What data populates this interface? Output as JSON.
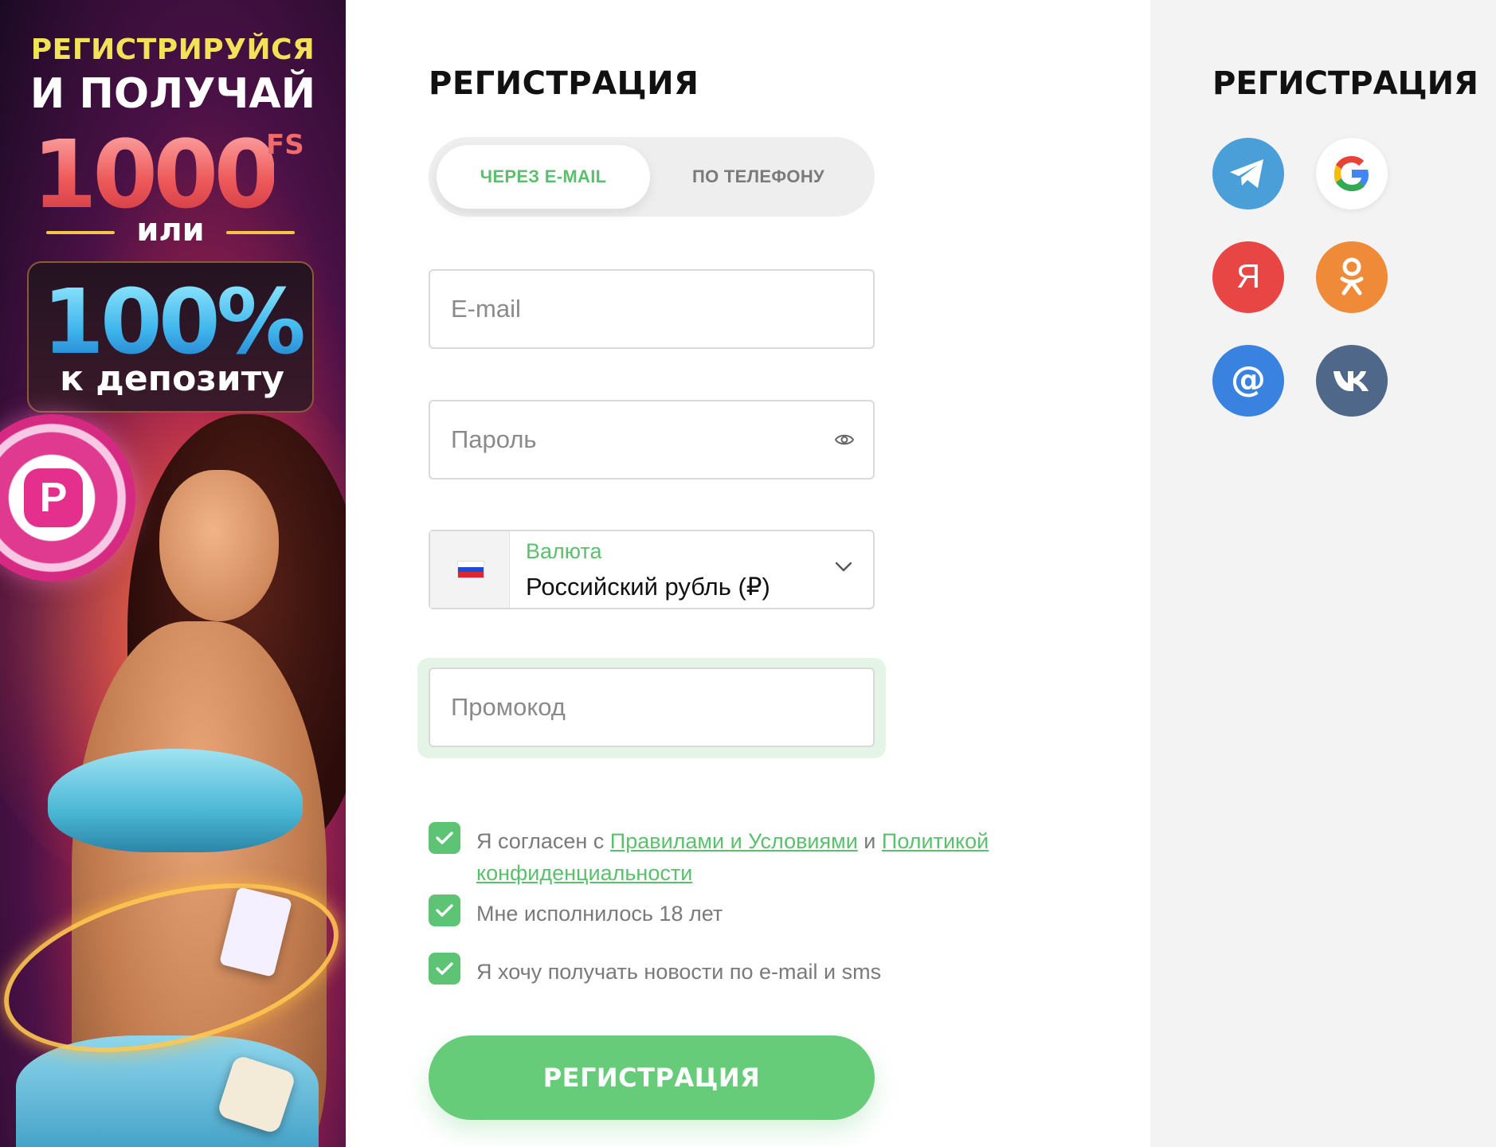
{
  "banner": {
    "line1": "РЕГИСТРИРУЙСЯ",
    "line2": "И ПОЛУЧАЙ",
    "amount": "1000",
    "amount_suffix": "FS",
    "or": "или",
    "percent": "100%",
    "percent_caption": "к депозиту"
  },
  "form": {
    "title": "РЕГИСТРАЦИЯ",
    "tabs": [
      {
        "label": "ЧЕРЕЗ E-MAIL",
        "active": true
      },
      {
        "label": "ПО ТЕЛЕФОНУ",
        "active": false
      }
    ],
    "email": {
      "placeholder": "E-mail",
      "value": ""
    },
    "password": {
      "placeholder": "Пароль",
      "value": ""
    },
    "currency": {
      "label": "Валюта",
      "value": "Российский рубль (₽)"
    },
    "promo": {
      "placeholder": "Промокод",
      "value": ""
    },
    "checkboxes": {
      "terms": {
        "prefix": "Я согласен с",
        "link1": "Правилами и Условиями",
        "joiner": "и",
        "link2_line1": "Политикой",
        "link2_line2": "конфиденциальности",
        "checked": true
      },
      "age": {
        "label": "Мне исполнилось 18 лет",
        "checked": true
      },
      "news": {
        "label": "Я хочу получать новости по e-mail и sms",
        "checked": true
      }
    },
    "submit_label": "РЕГИСТРАЦИЯ"
  },
  "social": {
    "title": "РЕГИСТРАЦИЯ",
    "providers": [
      {
        "name": "telegram",
        "icon": "telegram-icon",
        "color": "#4a9fd9"
      },
      {
        "name": "google",
        "icon": "google-icon",
        "color": "#ffffff"
      },
      {
        "name": "yandex",
        "icon": "yandex-icon",
        "color": "#e84545",
        "glyph": "Я"
      },
      {
        "name": "odnoklassniki",
        "icon": "ok-icon",
        "color": "#ee8a38"
      },
      {
        "name": "mailru",
        "icon": "mailru-icon",
        "color": "#3a82e0",
        "glyph": "@"
      },
      {
        "name": "vk",
        "icon": "vk-icon",
        "color": "#4f6789"
      }
    ]
  },
  "colors": {
    "accent": "#66cc7a",
    "accent_text": "#5cbf6e",
    "panel_bg": "#f3f3f3"
  }
}
